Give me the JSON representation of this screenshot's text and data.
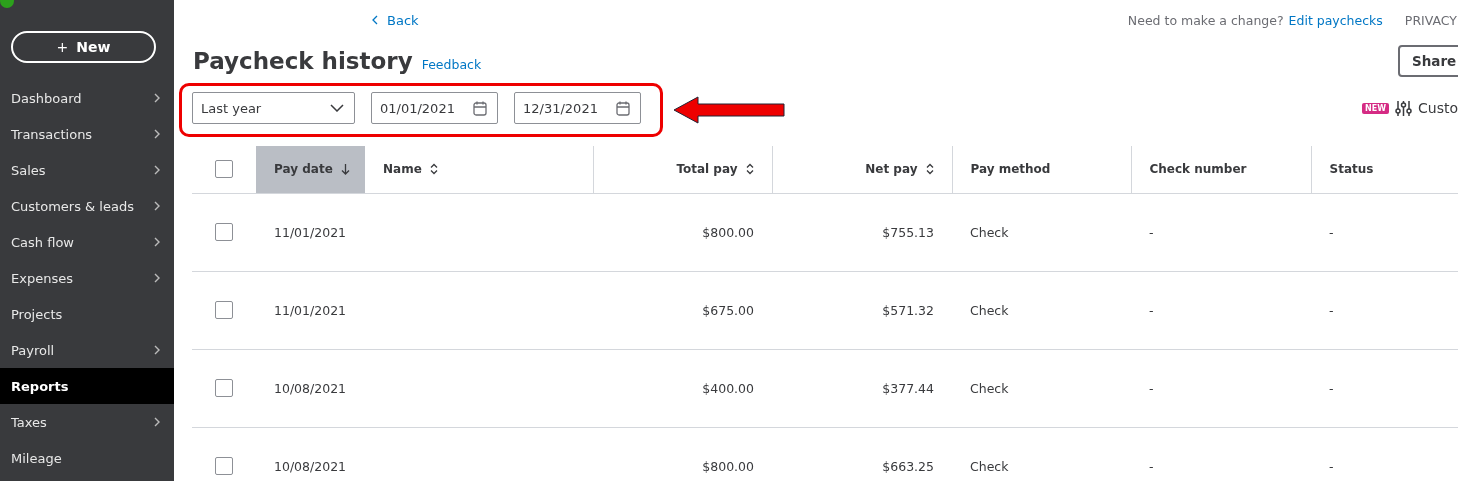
{
  "sidebar": {
    "new_button": {
      "icon": "+",
      "label": "New"
    },
    "items": [
      {
        "label": "Dashboard",
        "expandable": true,
        "selected": false
      },
      {
        "label": "Transactions",
        "expandable": true,
        "selected": false
      },
      {
        "label": "Sales",
        "expandable": true,
        "selected": false
      },
      {
        "label": "Customers & leads",
        "expandable": true,
        "selected": false
      },
      {
        "label": "Cash flow",
        "expandable": true,
        "selected": false
      },
      {
        "label": "Expenses",
        "expandable": true,
        "selected": false
      },
      {
        "label": "Projects",
        "expandable": false,
        "selected": false
      },
      {
        "label": "Payroll",
        "expandable": true,
        "selected": false
      },
      {
        "label": "Reports",
        "expandable": false,
        "selected": true
      },
      {
        "label": "Taxes",
        "expandable": true,
        "selected": false
      },
      {
        "label": "Mileage",
        "expandable": false,
        "selected": false
      }
    ]
  },
  "header": {
    "back": "Back",
    "notice": "Need to make a change?",
    "edit_link": "Edit paychecks",
    "privacy": "PRIVACY",
    "title": "Paycheck history",
    "feedback": "Feedback",
    "share": "Share"
  },
  "filters": {
    "period": "Last year",
    "start_date": "01/01/2021",
    "end_date": "12/31/2021"
  },
  "customize": {
    "badge": "NEW",
    "label": "Custo"
  },
  "table": {
    "all_checked": false,
    "columns": [
      {
        "label": "Pay date",
        "sortable": true,
        "selected": true
      },
      {
        "label": "Name",
        "sortable": true,
        "selected": false
      },
      {
        "label": "Total pay",
        "sortable": true,
        "selected": false
      },
      {
        "label": "Net pay",
        "sortable": true,
        "selected": false
      },
      {
        "label": "Pay method",
        "sortable": false,
        "selected": false
      },
      {
        "label": "Check number",
        "sortable": false,
        "selected": false
      },
      {
        "label": "Status",
        "sortable": false,
        "selected": false
      }
    ],
    "rows": [
      {
        "checked": false,
        "pay_date": "11/01/2021",
        "total_pay": "$800.00",
        "net_pay": "$755.13",
        "pay_method": "Check",
        "check_number": "-",
        "status": "-"
      },
      {
        "checked": false,
        "pay_date": "11/01/2021",
        "total_pay": "$675.00",
        "net_pay": "$571.32",
        "pay_method": "Check",
        "check_number": "-",
        "status": "-"
      },
      {
        "checked": false,
        "pay_date": "10/08/2021",
        "total_pay": "$400.00",
        "net_pay": "$377.44",
        "pay_method": "Check",
        "check_number": "-",
        "status": "-"
      },
      {
        "checked": false,
        "pay_date": "10/08/2021",
        "total_pay": "$800.00",
        "net_pay": "$663.25",
        "pay_method": "Check",
        "check_number": "-",
        "status": "-"
      }
    ]
  }
}
